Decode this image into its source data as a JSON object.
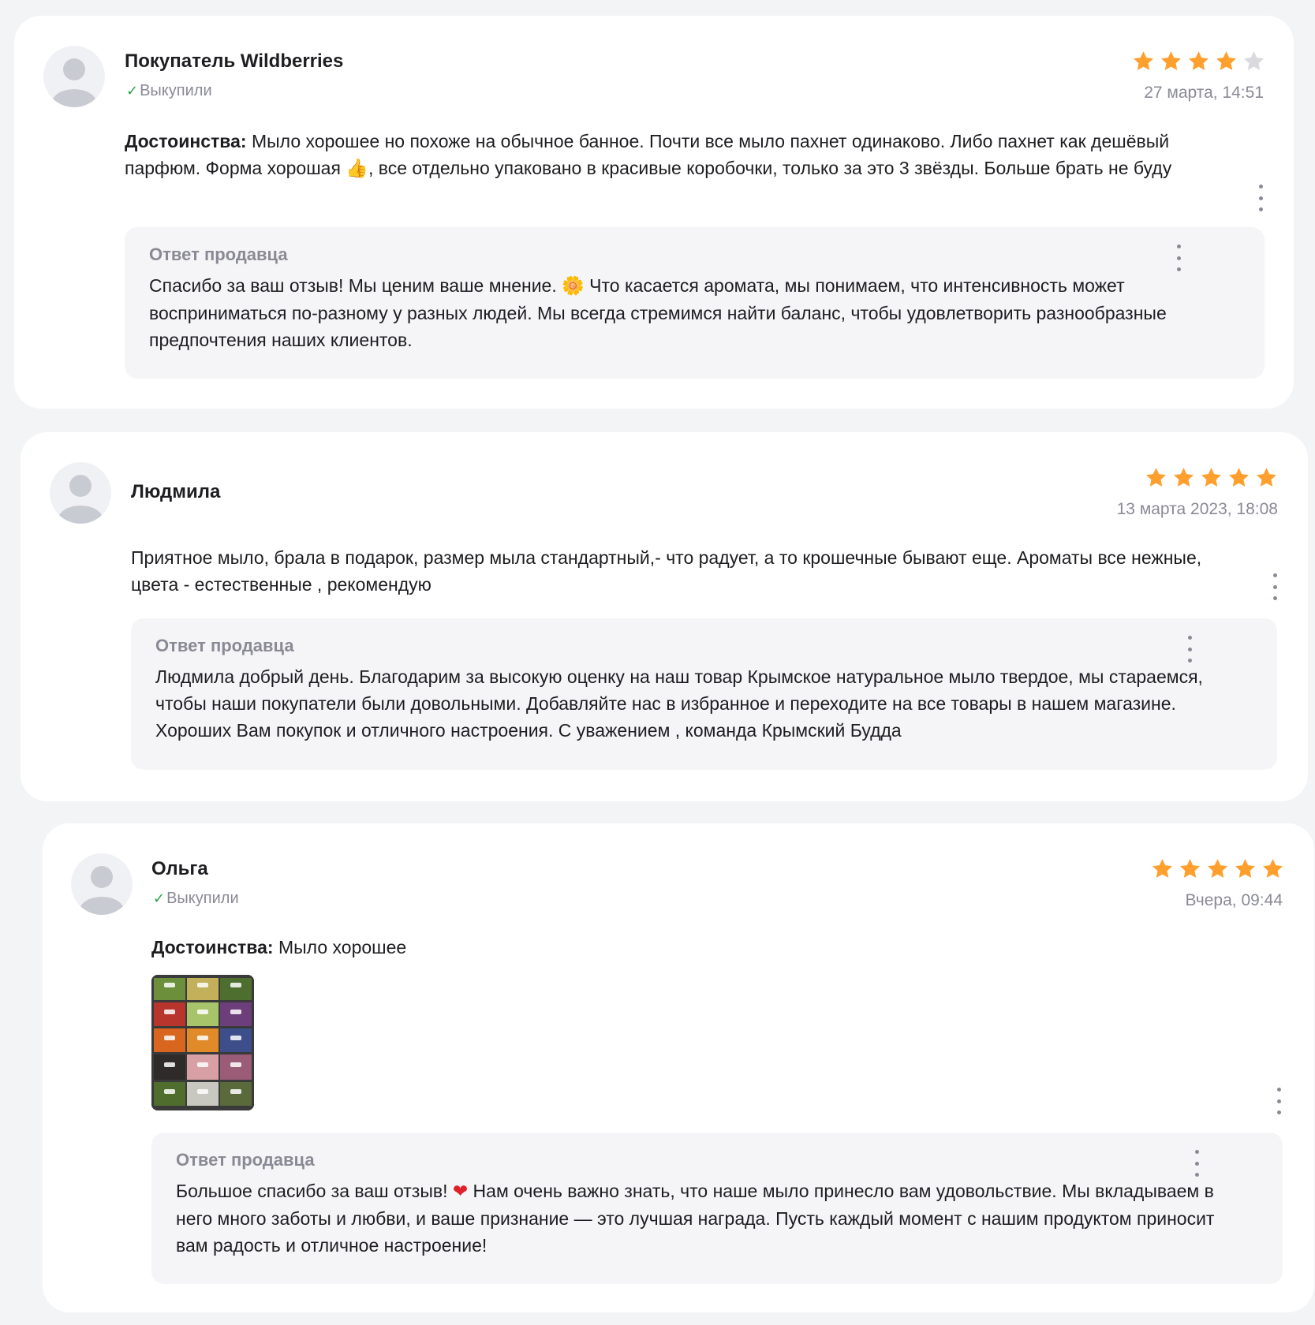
{
  "reviews": [
    {
      "author": "Покупатель Wildberries",
      "purchased": "Выкупили",
      "rating": 4,
      "date": "27 марта, 14:51",
      "pros_label": "Достоинства:",
      "text_part1": " Мыло хорошее но похоже на обычное банное. Почти все мыло пахнет одинаково. Либо пахнет как дешёвый парфюм. Форма хорошая ",
      "emoji": "👍",
      "text_part2": ", все отдельно упаковано в красивые коробочки, только за это 3 звёзды. Больше брать не буду",
      "reply_title": "Ответ продавца",
      "reply_part1": "Спасибо за ваш отзыв! Мы ценим ваше мнение. ",
      "reply_emoji": "🌼",
      "reply_part2": " Что касается аромата, мы понимаем, что интенсивность может восприниматься по-разному у разных людей. Мы всегда стремимся найти баланс, чтобы удовлетворить разнообразные предпочтения наших клиентов."
    },
    {
      "author": "Людмила",
      "rating": 5,
      "date": "13 марта 2023, 18:08",
      "text": "Приятное мыло, брала в подарок, размер мыла стандартный,- что радует, а то крошечные бывают еще. Ароматы все нежные, цвета - естественные , рекомендую",
      "reply_title": "Ответ продавца",
      "reply_text": "Людмила добрый день. Благодарим за высокую оценку на наш товар Крымское натуральное мыло твердое, мы стараемся, чтобы наши покупатели были довольными. Добавляйте нас в избранное и переходите на все товары в нашем магазине. Хороших Вам покупок и отличного настроения. С уважением , команда Крымский Будда"
    },
    {
      "author": "Ольга",
      "purchased": "Выкупили",
      "rating": 5,
      "date": "Вчера, 09:44",
      "pros_label": "Достоинства:",
      "text": " Мыло хорошее",
      "reply_title": "Ответ продавца",
      "reply_part1": "Большое спасибо за ваш отзыв! ",
      "reply_emoji": "❤",
      "reply_part2": " Нам очень важно знать, что наше мыло принесло вам удовольствие. Мы вкладываем в него много заботы и любви, и ваше признание — это лучшая награда. Пусть каждый момент с нашим продуктом приносит вам радость и отличное настроение!"
    }
  ],
  "colors": {
    "star_filled": "#ff9f2e",
    "star_empty": "#d9d9de",
    "check": "#29a34a",
    "muted": "#8a8a95"
  },
  "icons": {
    "avatar": "user-avatar-icon",
    "star": "star-icon",
    "check": "check-icon",
    "menu": "kebab-menu-icon"
  }
}
